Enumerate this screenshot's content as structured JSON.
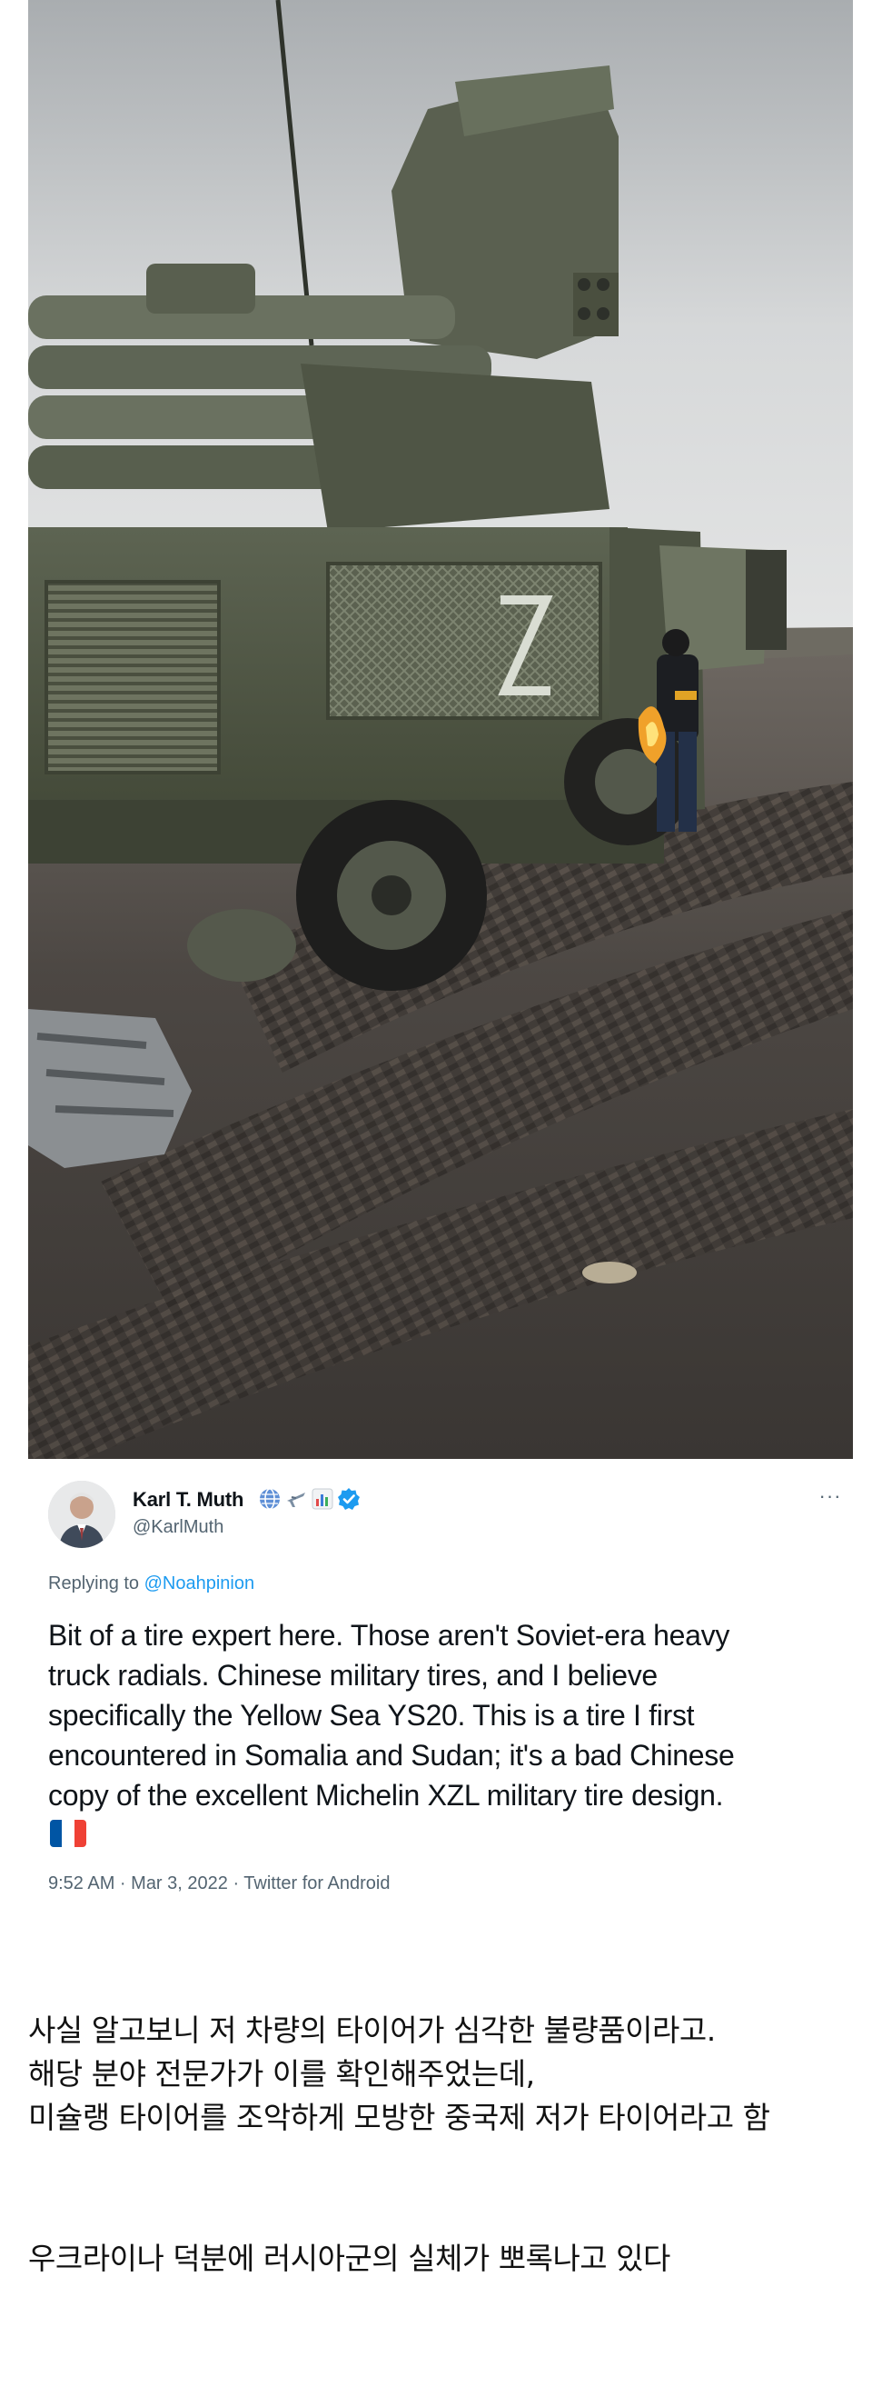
{
  "tweet": {
    "display_name": "Karl T. Muth",
    "handle": "@KarlMuth",
    "emoji_icons": [
      "globe-icon",
      "airplane-icon",
      "bar-chart-icon"
    ],
    "verified_icon": "verified-badge-icon",
    "more_icon": "more-options-icon",
    "replying_prefix": "Replying to",
    "replying_to": "@Noahpinion",
    "body_lines": [
      "Bit of a tire expert here. Those aren't Soviet-era heavy",
      "truck radials. Chinese military tires, and I believe",
      "specifically the Yellow Sea YS20. This is a tire I first",
      "encountered in Somalia and Sudan; it's a bad Chinese",
      "copy of the excellent Michelin XZL military tire design."
    ],
    "flag_icon": "france-flag-icon",
    "meta": "9:52 AM · Mar 3, 2022 · Twitter for Android"
  },
  "caption": {
    "lines": [
      "사실 알고보니 저 차량의 타이어가 심각한 불량품이라고.",
      "해당 분야 전문가가 이를 확인해주었는데,",
      "미슐랭 타이어를 조악하게 모방한 중국제 저가 타이어라고 함"
    ],
    "closing": "우크라이나 덕분에 러시아군의 실체가 뽀록나고 있다"
  },
  "colors": {
    "link": "#1d9bf0",
    "muted": "#536471",
    "text": "#0f1419",
    "flag_blue": "#0055a4",
    "flag_white": "#ffffff",
    "flag_red": "#ef4135"
  }
}
